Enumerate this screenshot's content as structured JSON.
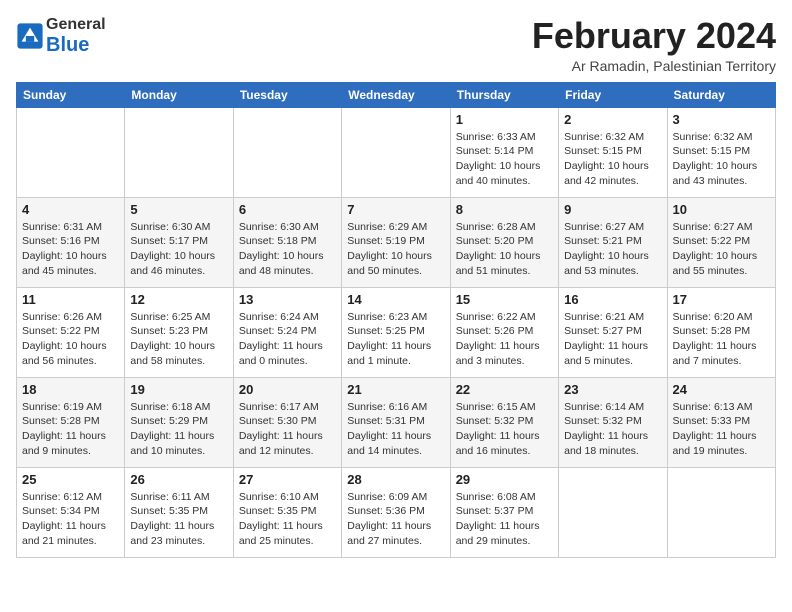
{
  "logo": {
    "general": "General",
    "blue": "Blue"
  },
  "header": {
    "month": "February 2024",
    "location": "Ar Ramadin, Palestinian Territory"
  },
  "weekdays": [
    "Sunday",
    "Monday",
    "Tuesday",
    "Wednesday",
    "Thursday",
    "Friday",
    "Saturday"
  ],
  "weeks": [
    [
      {
        "day": "",
        "info": ""
      },
      {
        "day": "",
        "info": ""
      },
      {
        "day": "",
        "info": ""
      },
      {
        "day": "",
        "info": ""
      },
      {
        "day": "1",
        "sunrise": "Sunrise: 6:33 AM",
        "sunset": "Sunset: 5:14 PM",
        "daylight": "Daylight: 10 hours and 40 minutes."
      },
      {
        "day": "2",
        "sunrise": "Sunrise: 6:32 AM",
        "sunset": "Sunset: 5:15 PM",
        "daylight": "Daylight: 10 hours and 42 minutes."
      },
      {
        "day": "3",
        "sunrise": "Sunrise: 6:32 AM",
        "sunset": "Sunset: 5:15 PM",
        "daylight": "Daylight: 10 hours and 43 minutes."
      }
    ],
    [
      {
        "day": "4",
        "sunrise": "Sunrise: 6:31 AM",
        "sunset": "Sunset: 5:16 PM",
        "daylight": "Daylight: 10 hours and 45 minutes."
      },
      {
        "day": "5",
        "sunrise": "Sunrise: 6:30 AM",
        "sunset": "Sunset: 5:17 PM",
        "daylight": "Daylight: 10 hours and 46 minutes."
      },
      {
        "day": "6",
        "sunrise": "Sunrise: 6:30 AM",
        "sunset": "Sunset: 5:18 PM",
        "daylight": "Daylight: 10 hours and 48 minutes."
      },
      {
        "day": "7",
        "sunrise": "Sunrise: 6:29 AM",
        "sunset": "Sunset: 5:19 PM",
        "daylight": "Daylight: 10 hours and 50 minutes."
      },
      {
        "day": "8",
        "sunrise": "Sunrise: 6:28 AM",
        "sunset": "Sunset: 5:20 PM",
        "daylight": "Daylight: 10 hours and 51 minutes."
      },
      {
        "day": "9",
        "sunrise": "Sunrise: 6:27 AM",
        "sunset": "Sunset: 5:21 PM",
        "daylight": "Daylight: 10 hours and 53 minutes."
      },
      {
        "day": "10",
        "sunrise": "Sunrise: 6:27 AM",
        "sunset": "Sunset: 5:22 PM",
        "daylight": "Daylight: 10 hours and 55 minutes."
      }
    ],
    [
      {
        "day": "11",
        "sunrise": "Sunrise: 6:26 AM",
        "sunset": "Sunset: 5:22 PM",
        "daylight": "Daylight: 10 hours and 56 minutes."
      },
      {
        "day": "12",
        "sunrise": "Sunrise: 6:25 AM",
        "sunset": "Sunset: 5:23 PM",
        "daylight": "Daylight: 10 hours and 58 minutes."
      },
      {
        "day": "13",
        "sunrise": "Sunrise: 6:24 AM",
        "sunset": "Sunset: 5:24 PM",
        "daylight": "Daylight: 11 hours and 0 minutes."
      },
      {
        "day": "14",
        "sunrise": "Sunrise: 6:23 AM",
        "sunset": "Sunset: 5:25 PM",
        "daylight": "Daylight: 11 hours and 1 minute."
      },
      {
        "day": "15",
        "sunrise": "Sunrise: 6:22 AM",
        "sunset": "Sunset: 5:26 PM",
        "daylight": "Daylight: 11 hours and 3 minutes."
      },
      {
        "day": "16",
        "sunrise": "Sunrise: 6:21 AM",
        "sunset": "Sunset: 5:27 PM",
        "daylight": "Daylight: 11 hours and 5 minutes."
      },
      {
        "day": "17",
        "sunrise": "Sunrise: 6:20 AM",
        "sunset": "Sunset: 5:28 PM",
        "daylight": "Daylight: 11 hours and 7 minutes."
      }
    ],
    [
      {
        "day": "18",
        "sunrise": "Sunrise: 6:19 AM",
        "sunset": "Sunset: 5:28 PM",
        "daylight": "Daylight: 11 hours and 9 minutes."
      },
      {
        "day": "19",
        "sunrise": "Sunrise: 6:18 AM",
        "sunset": "Sunset: 5:29 PM",
        "daylight": "Daylight: 11 hours and 10 minutes."
      },
      {
        "day": "20",
        "sunrise": "Sunrise: 6:17 AM",
        "sunset": "Sunset: 5:30 PM",
        "daylight": "Daylight: 11 hours and 12 minutes."
      },
      {
        "day": "21",
        "sunrise": "Sunrise: 6:16 AM",
        "sunset": "Sunset: 5:31 PM",
        "daylight": "Daylight: 11 hours and 14 minutes."
      },
      {
        "day": "22",
        "sunrise": "Sunrise: 6:15 AM",
        "sunset": "Sunset: 5:32 PM",
        "daylight": "Daylight: 11 hours and 16 minutes."
      },
      {
        "day": "23",
        "sunrise": "Sunrise: 6:14 AM",
        "sunset": "Sunset: 5:32 PM",
        "daylight": "Daylight: 11 hours and 18 minutes."
      },
      {
        "day": "24",
        "sunrise": "Sunrise: 6:13 AM",
        "sunset": "Sunset: 5:33 PM",
        "daylight": "Daylight: 11 hours and 19 minutes."
      }
    ],
    [
      {
        "day": "25",
        "sunrise": "Sunrise: 6:12 AM",
        "sunset": "Sunset: 5:34 PM",
        "daylight": "Daylight: 11 hours and 21 minutes."
      },
      {
        "day": "26",
        "sunrise": "Sunrise: 6:11 AM",
        "sunset": "Sunset: 5:35 PM",
        "daylight": "Daylight: 11 hours and 23 minutes."
      },
      {
        "day": "27",
        "sunrise": "Sunrise: 6:10 AM",
        "sunset": "Sunset: 5:35 PM",
        "daylight": "Daylight: 11 hours and 25 minutes."
      },
      {
        "day": "28",
        "sunrise": "Sunrise: 6:09 AM",
        "sunset": "Sunset: 5:36 PM",
        "daylight": "Daylight: 11 hours and 27 minutes."
      },
      {
        "day": "29",
        "sunrise": "Sunrise: 6:08 AM",
        "sunset": "Sunset: 5:37 PM",
        "daylight": "Daylight: 11 hours and 29 minutes."
      },
      {
        "day": "",
        "info": ""
      },
      {
        "day": "",
        "info": ""
      }
    ]
  ]
}
